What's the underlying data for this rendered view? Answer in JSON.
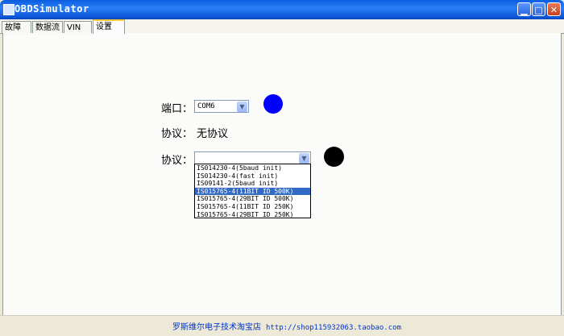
{
  "window": {
    "title": "OBDSimulator"
  },
  "tabs": [
    {
      "label": "故障码"
    },
    {
      "label": "数据流"
    },
    {
      "label": "VIN码"
    },
    {
      "label": "设置"
    }
  ],
  "settings": {
    "port_label": "端口：",
    "port_value": "COM6",
    "port_status_color": "#0000ff",
    "protocol_display_label": "协议：",
    "protocol_display_value": "无协议",
    "protocol_select_label": "协议：",
    "protocol_select_value": "",
    "protocol_status_color": "#000000",
    "protocol_options": [
      "IS014230-4(5baud init)",
      "IS014230-4(fast init)",
      "IS09141-2(5baud init)",
      "IS015765-4(11BIT ID 500K)",
      "IS015765-4(29BIT ID 500K)",
      "IS015765-4(11BIT ID 250K)",
      "IS015765-4(29BIT ID 250K)"
    ],
    "highlighted_option": "IS015765-4(11BIT ID 500K)"
  },
  "status_bar": {
    "shop_name": "罗斯维尔电子技术淘宝店",
    "url": "http://shop115932063.taobao.com"
  }
}
